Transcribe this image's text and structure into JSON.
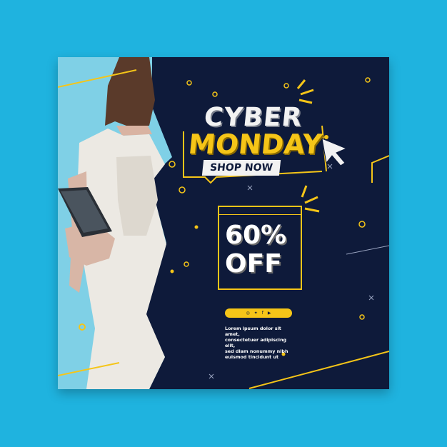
{
  "title": {
    "line1": "CYBER",
    "line2": "MONDAY",
    "button": "SHOP NOW"
  },
  "discount": {
    "line1": "60%",
    "line2": "OFF"
  },
  "social_icons": [
    "instagram-icon",
    "twitter-icon",
    "facebook-icon",
    "youtube-icon"
  ],
  "social_glyphs": [
    "◎",
    "✦",
    "f",
    "▶"
  ],
  "body_text": {
    "line1": "Lorem ipsum dolor sit amet,",
    "line2": "consectetuer adipiscing elit,",
    "line3": "sed diam nonummy nibh",
    "line4": "euismod tincidunt ut"
  },
  "colors": {
    "background": "#1fb3df",
    "card": "#0e1a3a",
    "accent": "#f5c518",
    "photo_bg": "#7fd0e6"
  }
}
